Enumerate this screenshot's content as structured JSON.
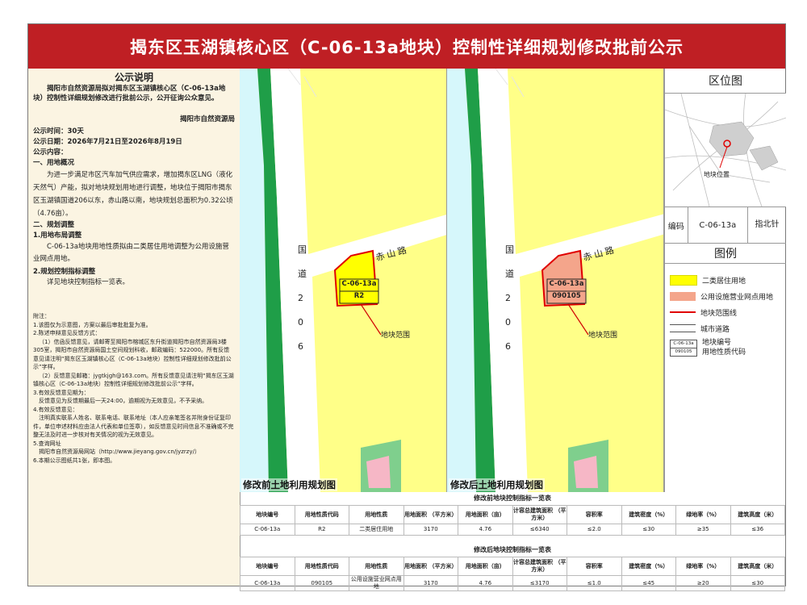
{
  "header": {
    "title": "揭东区玉湖镇核心区（C-06-13a地块）控制性详细规划修改批前公示"
  },
  "notice": {
    "heading": "公示说明",
    "intro": "揭阳市自然资源局拟对揭东区玉湖镇核心区（C-06-13a地块）控制性详细规划修改进行批前公示，公开征询公众意见。",
    "authority": "揭阳市自然资源局",
    "time": "公示时间：30天",
    "period": "公示日期：2026年7月21日至2026年8月19日",
    "content_title": "公示内容：",
    "s1_title": "一、用地概况",
    "s1_text": "为进一步满足市区汽车加气供应需求，增加揭东区LNG（液化天然气）产能，拟对地块规划用地进行调整，地块位于揭阳市揭东区玉湖镇国道206以东，赤山路以南，地块规划总面积为0.32公顷（4.76亩）。",
    "s2_title": "二、规划调整",
    "s2_1_title": "1.用地布局调整",
    "s2_1_text": "C-06-13a地块用地性质拟由二类居住用地调整为公用设施营业网点用地。",
    "s2_2_title": "2.规划控制指标调整",
    "s2_2_text": "详见地块控制指标一览表。"
  },
  "notes": {
    "title": "附注：",
    "lines": [
      "1.该图仅为示意图，方案以最后审批批复为准。",
      "2.陈述申辩意见反馈方式：",
      "（1）信函反馈意见，请邮寄至揭阳市榕城区东升街道揭阳市自然资源局3楼305室，揭阳市自然资源局国土空间规划科收，邮政编码：522000。所有反馈意见请注明“揭东区玉湖镇核心区（C-06-13a地块）控制性详细规划修改批前公示”字样。",
      "（2）反馈意见邮箱：jygtkjgh@163.com。所有反馈意见请注明“揭东区玉湖镇核心区（C-06-13a地块）控制性详细规划修改批前公示”字样。",
      "3.有效反馈意见期为：",
      "反馈意见为反馈期最后一天24:00，逾期视为无效意见，不予采纳。",
      "4.有效反馈意见：",
      "注明真实联系人姓名、联系电话、联系地址（本人应亲笔签名并附身份证复印件，单位申述材料应由法人代表和单位签章），如反馈意见时间信息不准确或不完整无法及时进一步核对有关情况的视为无效意见。",
      "5.查询网址",
      "揭阳市自然资源局网站（http://www.jieyang.gov.cn/jyzrzy/）",
      "6.本期公示图纸共1张，即本图。"
    ]
  },
  "map_labels": {
    "road_national": [
      "国",
      "道",
      "2",
      "0",
      "6"
    ],
    "road_chishan": "赤山路",
    "plot_range": "地块范围",
    "plot_code": "C-06-13a",
    "before_use": "R2",
    "after_use": "090105",
    "before_caption": "修改前土地利用规划图",
    "after_caption": "修改后土地利用规划图"
  },
  "location": {
    "heading": "区位图",
    "plot_label": "地块位置"
  },
  "code_box": {
    "label": "编码",
    "value": "C-06-13a",
    "north": "指北针"
  },
  "legend": {
    "heading": "图例",
    "items": [
      {
        "label": "二类居住用地",
        "color": "#ffff00"
      },
      {
        "label": "公用设施营业网点用地",
        "color": "#f4a58b"
      },
      {
        "label": "地块范围线",
        "color": "#e00000"
      },
      {
        "label": "城市道路",
        "color": "#ffffff"
      }
    ],
    "sample_code": "C-06-13a",
    "sample_use": "090105",
    "code_label_1": "地块编号",
    "code_label_2": "用地性质代码"
  },
  "tables": {
    "before_title": "修改前地块控制指标一览表",
    "after_title": "修改后地块控制指标一览表",
    "headers": [
      "地块编号",
      "用地性质代码",
      "用地性质",
      "用地面积\n（平方米）",
      "用地面积（亩）",
      "计容总建筑面积\n（平方米）",
      "容积率",
      "建筑密度（%）",
      "绿地率（%）",
      "建筑高度（米）"
    ],
    "before_row": [
      "C-06-13a",
      "R2",
      "二类居住用地",
      "3170",
      "4.76",
      "≤6340",
      "≤2.0",
      "≤30",
      "≥35",
      "≤36"
    ],
    "after_row": [
      "C-06-13a",
      "090105",
      "公用设施营业网点用地",
      "3170",
      "4.76",
      "≤3170",
      "≤1.0",
      "≤45",
      "≥20",
      "≤30"
    ]
  }
}
